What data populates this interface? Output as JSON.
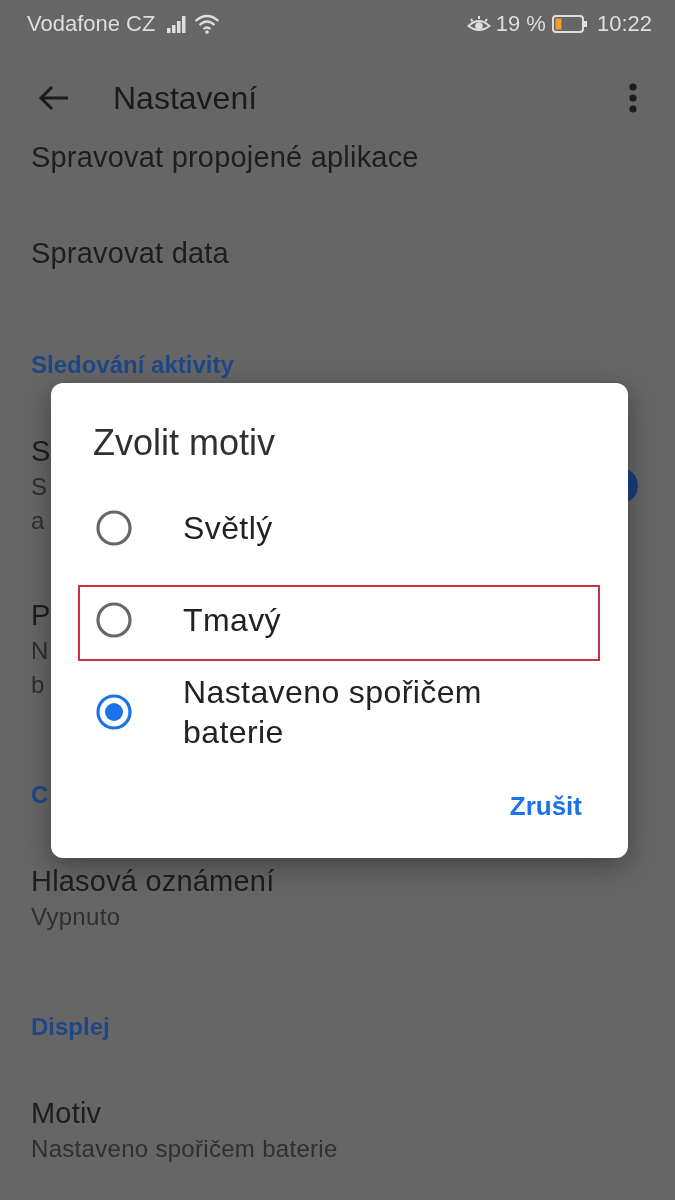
{
  "status_bar": {
    "carrier": "Vodafone CZ",
    "battery_percent": "19 %",
    "time": "10:22"
  },
  "toolbar": {
    "title": "Nastavení"
  },
  "settings": [
    {
      "kind": "item",
      "title": "Spravovat propojené aplikace"
    },
    {
      "kind": "item",
      "title": "Spravovat data"
    },
    {
      "kind": "header",
      "title": "Sledování aktivity"
    },
    {
      "kind": "item",
      "title": "S",
      "summary_lines": [
        "S",
        "a"
      ],
      "switch_on": true
    },
    {
      "kind": "item",
      "title": "P",
      "summary_lines": [
        "N",
        "b"
      ]
    },
    {
      "kind": "header",
      "title": "C"
    },
    {
      "kind": "item",
      "title": "Hlasová oznámení",
      "summary_lines": [
        "Vypnuto"
      ]
    },
    {
      "kind": "header",
      "title": "Displej"
    },
    {
      "kind": "item",
      "title": "Motiv",
      "summary_lines": [
        "Nastaveno spořičem baterie"
      ]
    }
  ],
  "dialog": {
    "title": "Zvolit motiv",
    "options": [
      {
        "label": "Světlý",
        "selected": false,
        "highlighted": false
      },
      {
        "label": "Tmavý",
        "selected": false,
        "highlighted": true
      },
      {
        "label": "Nastaveno spořičem baterie",
        "selected": true,
        "highlighted": false
      }
    ],
    "cancel": "Zrušit"
  }
}
